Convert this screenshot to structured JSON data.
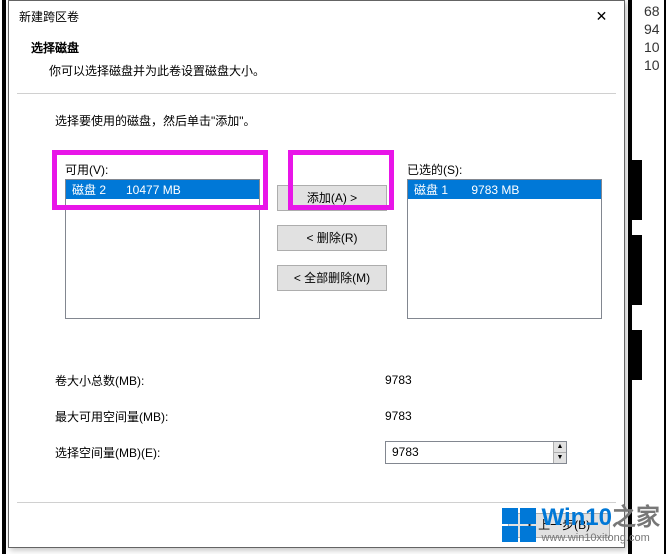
{
  "bg": {
    "right_numbers": [
      "68",
      "94",
      "10",
      "10"
    ]
  },
  "dialog": {
    "title": "新建跨区卷",
    "close_glyph": "✕",
    "header_title": "选择磁盘",
    "header_sub": "你可以选择磁盘并为此卷设置磁盘大小。",
    "instruction": "选择要使用的磁盘，然后单击\"添加\"。"
  },
  "available": {
    "label": "可用(V):",
    "item_label": "磁盘 2      10477 MB"
  },
  "selected": {
    "label": "已选的(S):",
    "item_label": "磁盘 1       9783 MB"
  },
  "buttons": {
    "add": "添加(A) >",
    "remove": "< 删除(R)",
    "remove_all": "< 全部删除(M)",
    "back": "< 上一步(B)"
  },
  "form": {
    "total_label": "卷大小总数(MB):",
    "total_value": "9783",
    "max_label": "最大可用空间量(MB):",
    "max_value": "9783",
    "select_label": "选择空间量(MB)(E):",
    "select_value": "9783"
  },
  "watermark": {
    "brand1": "Win10",
    "brand2": "之家",
    "url": "www.win10xitong.com"
  }
}
